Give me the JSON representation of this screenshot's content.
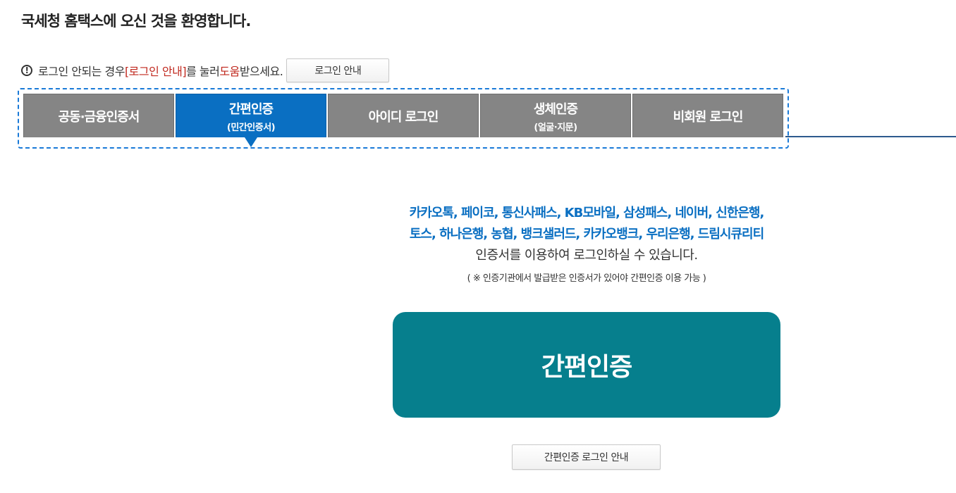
{
  "header": {
    "welcome": "국세청 홈택스에 오신 것을 환영합니다."
  },
  "notice": {
    "icon": "exclamation-circle-icon",
    "text_before": "로그인 안되는 경우 ",
    "link_text": "[로그인 안내]",
    "text_middle": "를 눌러 ",
    "highlight": "도움",
    "text_after": "받으세요.",
    "button_label": "로그인 안내",
    "highlight_color": "#c0281e"
  },
  "tabs": [
    {
      "label": "공동·금융인증서",
      "sub": ""
    },
    {
      "label": "간편인증",
      "sub": "(민간인증서)",
      "active": true
    },
    {
      "label": "아이디 로그인",
      "sub": ""
    },
    {
      "label": "생체인증",
      "sub": "(얼굴·지문)"
    },
    {
      "label": "비회원 로그인",
      "sub": ""
    }
  ],
  "info": {
    "providers_line1": "카카오톡, 페이코, 통신사패스, KB모바일, 삼성패스, 네이버, 신한은행,",
    "providers_line2": "토스, 하나은행, 농협, 뱅크샐러드, 카카오뱅크, 우리은행, 드림시큐리티",
    "description": "인증서를 이용하여 로그인하실 수 있습니다.",
    "note": "( ※ 인증기관에서 발급받은 인증서가 있어야 간편인증 이용 가능 )"
  },
  "main_button": {
    "label": "간편인증"
  },
  "guide_button": {
    "label": "간편인증 로그인 안내"
  },
  "colors": {
    "active_tab": "#0a6fc2",
    "inactive_tab": "#858585",
    "main_button": "#067f8d",
    "provider_text": "#0a6fc2"
  }
}
